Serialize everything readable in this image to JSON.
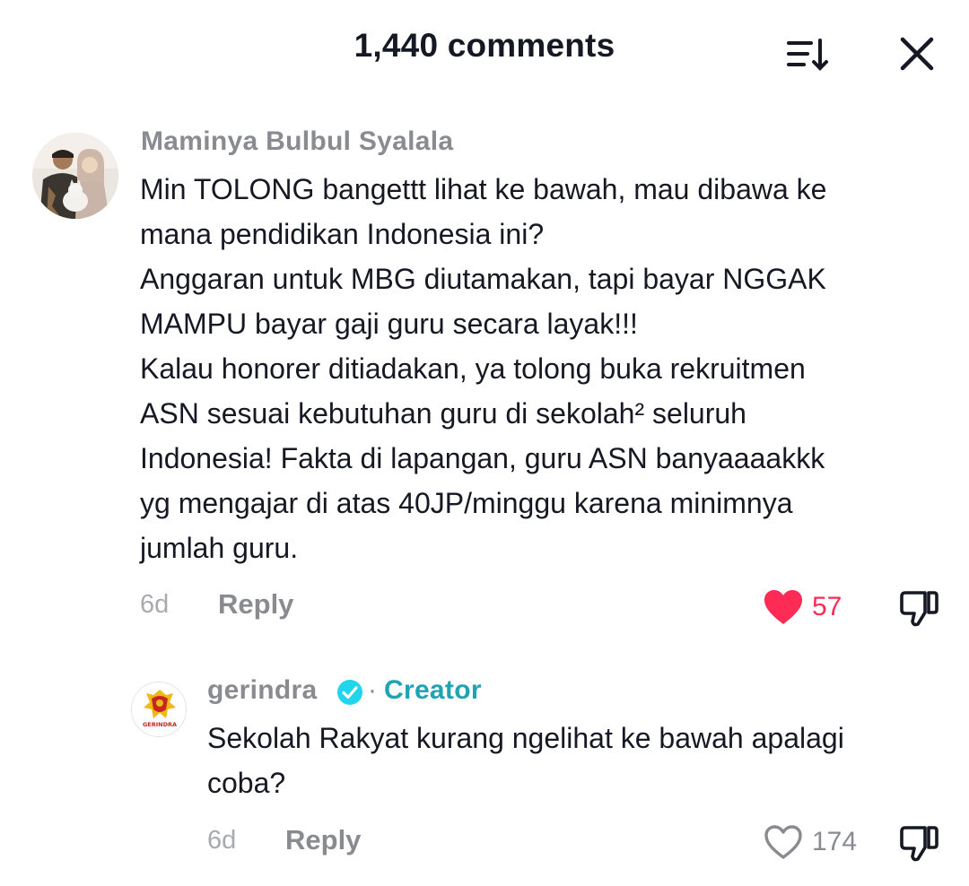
{
  "header": {
    "title": "1,440 comments",
    "sort_icon": "sort-descending-icon",
    "close_icon": "close-icon"
  },
  "comments": [
    {
      "username": "Maminya Bulbul Syalala",
      "avatar": "avatar-photo-couple",
      "text": "Min TOLONG bangettt lihat ke bawah, mau dibawa ke\nmana pendidikan Indonesia ini?\nAnggaran untuk MBG diutamakan, tapi bayar NGGAK\nMAMPU bayar gaji guru secara layak!!!\nKalau honorer ditiadakan, ya tolong buka rekruitmen\nASN sesuai kebutuhan guru di sekolah² seluruh\nIndonesia! Fakta di lapangan, guru ASN banyaaaakkk\nyg mengajar di atas 40JP/minggu karena minimnya\njumlah guru.",
      "time": "6d",
      "reply_label": "Reply",
      "likes": "57",
      "liked": true,
      "like_color": "#fe2c55"
    },
    {
      "username": "gerindra",
      "avatar": "gerindra-logo",
      "verified": true,
      "separator": "·",
      "badge": "Creator",
      "logo_text": "GERINDRA",
      "text": "Sekolah Rakyat kurang ngelihat ke bawah apalagi\ncoba?",
      "time": "6d",
      "reply_label": "Reply",
      "likes": "174",
      "liked": false
    }
  ],
  "colors": {
    "accent_like": "#fe2c55",
    "creator": "#20a3b3",
    "verified": "#20d5ec",
    "muted": "#8a8b91"
  }
}
